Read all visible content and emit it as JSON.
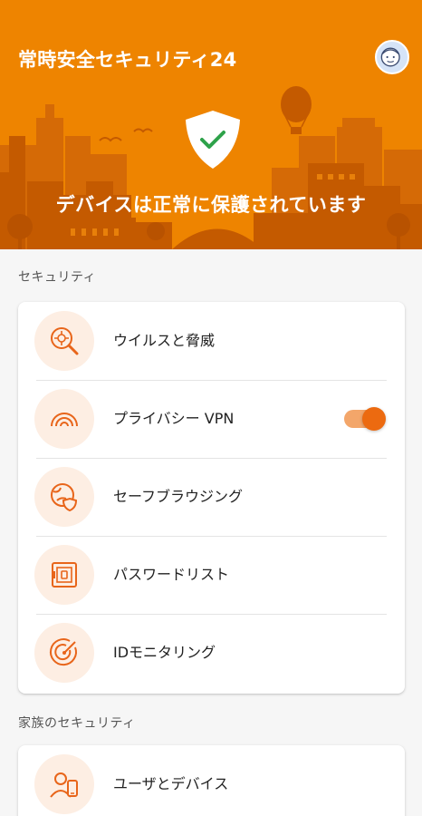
{
  "header": {
    "app_title": "常時安全セキュリティ24",
    "status_text": "デバイスは正常に保護されています",
    "colors": {
      "background": "#ee8400",
      "skyline": "#c75a00",
      "skyline_light": "#d86e08"
    }
  },
  "security_section": {
    "label": "セキュリティ",
    "items": [
      {
        "label": "ウイルスと脅威",
        "icon": "virus-magnifier-icon"
      },
      {
        "label": "プライバシー VPN",
        "icon": "vpn-signal-icon",
        "toggle_on": true
      },
      {
        "label": "セーフブラウジング",
        "icon": "globe-shield-icon"
      },
      {
        "label": "パスワードリスト",
        "icon": "password-safe-icon"
      },
      {
        "label": "IDモニタリング",
        "icon": "radar-icon"
      }
    ]
  },
  "family_section": {
    "label": "家族のセキュリティ",
    "items": [
      {
        "label": "ユーザとデバイス",
        "icon": "user-device-icon"
      }
    ]
  },
  "colors": {
    "accent": "#ec6a10",
    "icon_bg": "#fdeee3",
    "icon_stroke": "#e8651a"
  }
}
